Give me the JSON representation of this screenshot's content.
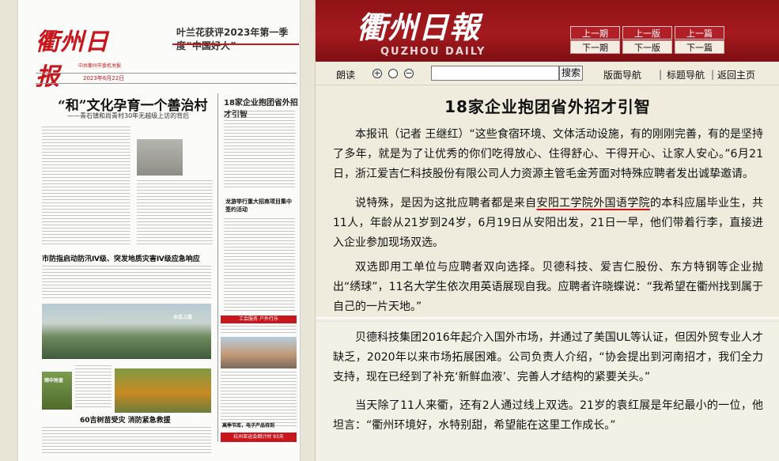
{
  "paper": {
    "masthead": "衢州日报",
    "masthead_sub": "中共衢州市委机关报",
    "top_headline": "叶兰花获评2023年第一季度“中国好人”",
    "date_strip": "2023年6月22日",
    "lead_headline": "“和”文化孕育一个善治村",
    "lead_subhead": "——青石镇和尚青村30年无越级上访的背后",
    "side_headline": "18家企业抱团省外招才引智",
    "side_headline_2": "龙游举行重大招商项目集中签约活动",
    "headline_flood": "市防指启动防汛Ⅳ级、突发地质灾害Ⅳ级应急响应",
    "banner_1": "工会服务 户外行乐",
    "caption_rain": "水位上涨",
    "caption_rain2": "雨中抢查",
    "headline_bottom": "60吉树苗受灾 消防紧急救援",
    "banner_2": "杭州亚运会倒计时 93天",
    "bottom_right": "高季节库，电子产品待到"
  },
  "header": {
    "logo": "衢州日報",
    "logo_sub": "QUZHOU DAILY",
    "nav": {
      "prev_issue": "上一期",
      "next_issue": "下一期",
      "prev_page": "上一版",
      "next_page": "下一版",
      "prev_article": "上一篇",
      "next_article": "下一篇"
    }
  },
  "toolbar": {
    "read_label": "朗读",
    "zoom_in": "+",
    "zoom_reset": "⊙",
    "zoom_out": "−",
    "search_value": "",
    "search_button": "搜索",
    "page_nav": "版面导航",
    "title_nav": "标题导航",
    "home": "返回主页",
    "sep": "|"
  },
  "article": {
    "title": "18家企业抱团省外招才引智",
    "p1": "本报讯（记者 王继红）“这些食宿环境、文体活动设施，有的刚刚完善，有的是坚持了多年，就是为了让优秀的你们吃得放心、住得舒心、干得开心、让家人安心。”6月21日，浙江爱吉仁科技股份有限公司人力资源主管毛金芳面对特殊应聘者发出诚挚邀请。",
    "p2_a": "说特殊，是因为这批应聘者都是来自",
    "p2_underlined": "安阳工学院外国语学院",
    "p2_b": "的本科应届毕业生，共11人，年龄从21岁到24岁，6月19日从安阳出发，21日一早，他们带着行李，直接进入企业参加现场双选。",
    "p3": "双选即用工单位与应聘者双向选择。贝德科技、爱吉仁股份、东方特钢等企业抛出“绣球”，11名大学生依次用英语展现自我。应聘者许晓蝶说：“我希望在衢州找到属于自己的一片天地。”",
    "p4": "贝德科技集团2016年起介入国外市场，并通过了美国UL等认证，但因外贸专业人才缺乏，2020年以来市场拓展困难。公司负责人介绍，“协会提出到河南招才，我们全力支持，现在已经到了补充‘新鲜血液’、完善人才结构的紧要关头。”",
    "p5": "当天除了11人来衢，还有2人通过线上双选。21岁的袁红展是年纪最小的一位，他坦言：“衢州环境好，水特别甜，希望能在这里工作成长。”"
  }
}
